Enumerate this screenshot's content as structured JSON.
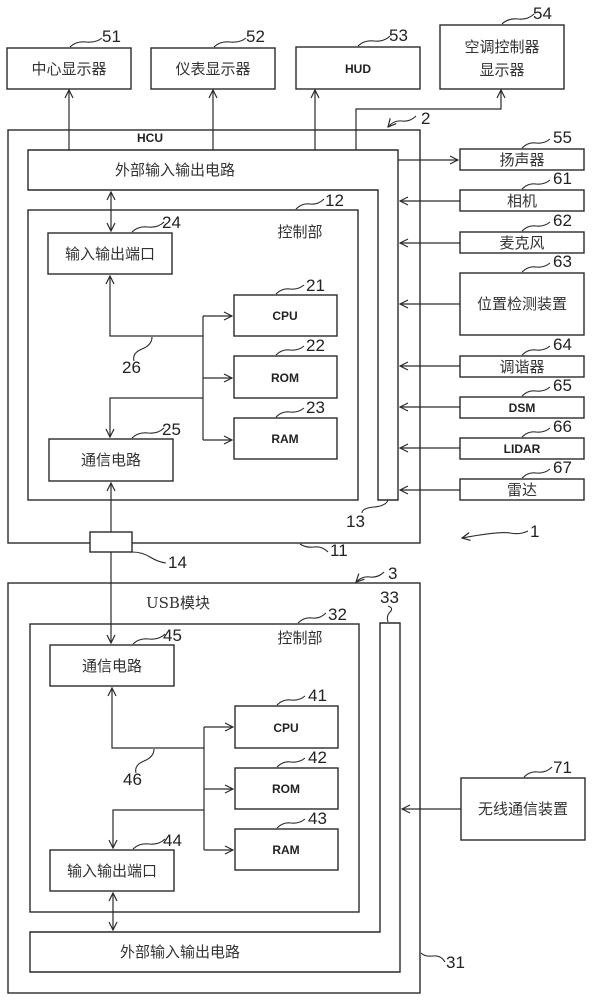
{
  "figure": {
    "system_ref": "1",
    "top_displays": [
      {
        "ref": "51",
        "label": "中心显示器"
      },
      {
        "ref": "52",
        "label": "仪表显示器"
      },
      {
        "ref": "53",
        "label": "HUD"
      },
      {
        "ref": "54",
        "label_line1": "空调控制器",
        "label_line2": "显示器"
      }
    ],
    "hcu": {
      "ref": "2",
      "housing_ref": "11",
      "title": "HCU",
      "external_io": {
        "ref": "13",
        "label": "外部输入输出电路"
      },
      "control": {
        "ref": "12",
        "label": "控制部",
        "io_port": {
          "ref": "24",
          "label": "输入输出端口"
        },
        "cpu": {
          "ref": "21",
          "label": "CPU"
        },
        "rom": {
          "ref": "22",
          "label": "ROM"
        },
        "ram": {
          "ref": "23",
          "label": "RAM"
        },
        "comm": {
          "ref": "25",
          "label": "通信电路"
        },
        "bus_ref": "26"
      },
      "connector_ref": "14"
    },
    "peripherals": [
      {
        "ref": "55",
        "label": "扬声器",
        "direction": "output"
      },
      {
        "ref": "61",
        "label": "相机",
        "direction": "input"
      },
      {
        "ref": "62",
        "label": "麦克风",
        "direction": "input"
      },
      {
        "ref": "63",
        "label": "位置检测装置",
        "direction": "input"
      },
      {
        "ref": "64",
        "label": "调谐器",
        "direction": "input"
      },
      {
        "ref": "65",
        "label": "DSM",
        "direction": "input"
      },
      {
        "ref": "66",
        "label": "LIDAR",
        "direction": "input"
      },
      {
        "ref": "67",
        "label": "雷达",
        "direction": "input"
      }
    ],
    "usb": {
      "ref": "3",
      "housing_ref": "31",
      "title": "USB模块",
      "external_io": {
        "ref": "33",
        "label": "外部输入输出电路"
      },
      "control": {
        "ref": "32",
        "label": "控制部",
        "comm": {
          "ref": "45",
          "label": "通信电路"
        },
        "cpu": {
          "ref": "41",
          "label": "CPU"
        },
        "rom": {
          "ref": "42",
          "label": "ROM"
        },
        "ram": {
          "ref": "43",
          "label": "RAM"
        },
        "io_port": {
          "ref": "44",
          "label": "输入输出端口"
        },
        "bus_ref": "46"
      }
    },
    "wireless": {
      "ref": "71",
      "label": "无线通信装置"
    }
  }
}
